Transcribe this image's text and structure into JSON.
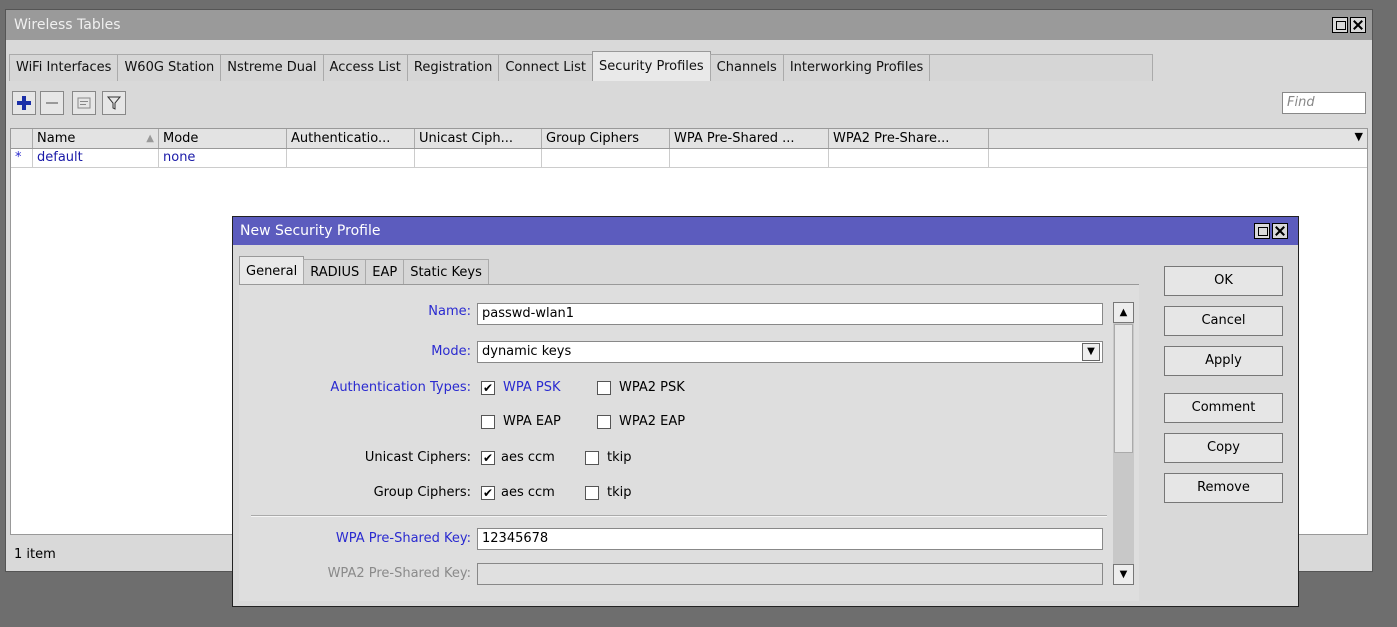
{
  "window": {
    "title": "Wireless Tables",
    "tabs": [
      "WiFi Interfaces",
      "W60G Station",
      "Nstreme Dual",
      "Access List",
      "Registration",
      "Connect List",
      "Security Profiles",
      "Channels",
      "Interworking Profiles"
    ],
    "active_tab": "Security Profiles",
    "find_placeholder": "Find",
    "columns": [
      "Name",
      "Mode",
      "Authenticatio...",
      "Unicast Ciph...",
      "Group Ciphers",
      "WPA Pre-Shared ...",
      "WPA2 Pre-Share..."
    ],
    "rows": [
      {
        "flag": "*",
        "name": "default",
        "mode": "none"
      }
    ],
    "status": "1 item"
  },
  "dialog": {
    "title": "New Security Profile",
    "tabs": [
      "General",
      "RADIUS",
      "EAP",
      "Static Keys"
    ],
    "active_tab": "General",
    "labels": {
      "name": "Name:",
      "mode": "Mode:",
      "auth_types": "Authentication Types:",
      "unicast": "Unicast Ciphers:",
      "group": "Group Ciphers:",
      "wpa_psk": "WPA Pre-Shared Key:",
      "wpa2_psk": "WPA2 Pre-Shared Key:"
    },
    "name_value": "passwd-wlan1",
    "mode_value": "dynamic keys",
    "auth_options": [
      {
        "label": "WPA PSK",
        "checked": true
      },
      {
        "label": "WPA2 PSK",
        "checked": false
      },
      {
        "label": "WPA EAP",
        "checked": false
      },
      {
        "label": "WPA2 EAP",
        "checked": false
      }
    ],
    "unicast_options": [
      {
        "label": "aes ccm",
        "checked": true
      },
      {
        "label": "tkip",
        "checked": false
      }
    ],
    "group_options": [
      {
        "label": "aes ccm",
        "checked": true
      },
      {
        "label": "tkip",
        "checked": false
      }
    ],
    "wpa_psk_value": "12345678",
    "wpa2_psk_value": "",
    "buttons": [
      "OK",
      "Cancel",
      "Apply",
      "Comment",
      "Copy",
      "Remove"
    ]
  },
  "colors": {
    "window_title_bg": "#9a9a9a",
    "dialog_title_bg": "#5c5cbe",
    "link_blue": "#2a2ad0"
  }
}
